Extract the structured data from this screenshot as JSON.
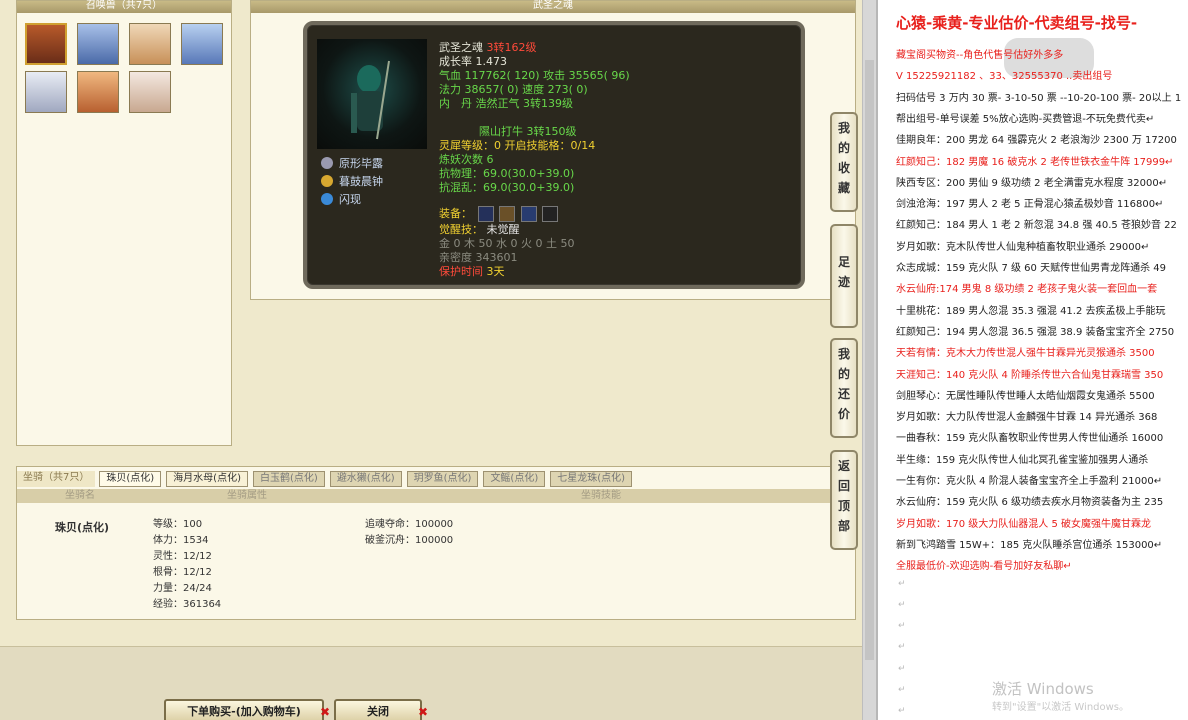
{
  "summon_panel": {
    "title": "召唤兽（共7只）"
  },
  "pet_frame": {
    "title": "武圣之魂"
  },
  "pet": {
    "name": "武圣之魂",
    "level": "3转162级",
    "growth": "成长率 1.473",
    "hp_label": "气血",
    "hp": "117762( 120)",
    "atk_label": "攻击",
    "atk": "35565( 96)",
    "mp_label": "法力",
    "mp": "38657( 0)",
    "spd_label": "速度",
    "spd": "273( 0)",
    "inner": "内　丹 浩然正气 3转139级",
    "city": "隰山打牛 3转150级",
    "rank_label": "灵犀等级",
    "rank": "：0 开启技能格：0/14",
    "refine": "炼妖次数 6",
    "resist1_label": "抗物理",
    "resist1": "69.0(30.0+39.0)",
    "resist2_label": "抗混乱",
    "resist2": "69.0(30.0+39.0)",
    "equip_label": "装备：",
    "awaken_label": "觉醒技：",
    "awaken": "未觉醒",
    "elements": "金 0 木 50 水 0 火 0 土 50",
    "intimacy": "亲密度 343601",
    "protect_label": "保护时间",
    "protect": "3天",
    "skills": [
      {
        "name": "原形毕露",
        "icon": "bone-skill-icon",
        "color": "#9a9ab0"
      },
      {
        "name": "暮鼓晨钟",
        "icon": "bell-skill-icon",
        "color": "#d8a830"
      },
      {
        "name": "闪现",
        "icon": "flash-skill-icon",
        "color": "#3a8ad8"
      }
    ]
  },
  "mount": {
    "tabs": [
      "坐骑（共7只）",
      "珠贝(点化)",
      "海月水母(点化)",
      "白玉鹤(点化)",
      "避水獭(点化)",
      "玥罗鱼(点化)",
      "文鳐(点化)",
      "七星龙珠(点化)"
    ],
    "col_name": "坐骑名",
    "col_attr": "坐骑属性",
    "col_skill": "坐骑技能",
    "name": "珠贝(点化)",
    "attrs": [
      "等级：100",
      "体力：1534",
      "灵性：12/12",
      "根骨：12/12",
      "力量：24/24",
      "经验：361364"
    ],
    "skills": [
      "追魂夺命：100000",
      "破釜沉舟：100000"
    ]
  },
  "buttons": {
    "buy": "下单购买-(加入购物车)",
    "close": "关闭",
    "x": "✖"
  },
  "side_nav": [
    {
      "label": "我的收藏",
      "chars": [
        "我",
        "的",
        "收",
        "藏"
      ]
    },
    {
      "label": "足迹",
      "chars": [
        "足",
        "迹"
      ]
    },
    {
      "label": "我的还价",
      "chars": [
        "我",
        "的",
        "还",
        "价"
      ]
    },
    {
      "label": "返回顶部",
      "chars": [
        "返",
        "回",
        "顶",
        "部"
      ]
    }
  ],
  "notepad": {
    "title": "心猿-乘黄-专业估价-代卖组号-找号-",
    "lines": [
      {
        "text": "藏宝阁买物资--角色代售号估好外多多",
        "red": true
      },
      {
        "text": "V 15225921182  、33、32555370  ..卖出组号",
        "red": true
      },
      {
        "text": "扫码估号 3 万内 30 票- 3-10-50 票  --10-20-100 票- 20以上 1",
        "red": false
      },
      {
        "text": "帮出组号-单号误差 5%放心选购-买费管退-不玩免费代卖↵",
        "red": false
      },
      {
        "text": "佳期良年：200 男龙 64 强霹克火 2 老浪淘沙 2300 万 17200",
        "red": false
      },
      {
        "text": "红颜知己：182 男魔 16 破克水 2 老传世铁衣金牛阵 17999↵",
        "red": true
      },
      {
        "text": "陕西专区：200 男仙 9 级功绩 2 老全满雷克水程度 32000↵",
        "red": false
      },
      {
        "text": "剑浊沧海：197 男人 2 老 5 正骨混心猿孟极妙音 116800↵",
        "red": false
      },
      {
        "text": "红颜知己：184 男人 1 老 2 新忽混 34.8 强 40.5 苍狼妙音 22",
        "red": false
      },
      {
        "text": "岁月如歌：克木队传世人仙鬼种植畜牧职业通杀 29000↵",
        "red": false
      },
      {
        "text": "众志成城：159 克火队 7 级 60 天赋传世仙男青龙阵通杀 49",
        "red": false
      },
      {
        "text": "水云仙府:174 男鬼 8 级功绩 2 老孩子鬼火装一套回血一套",
        "red": true
      },
      {
        "text": "十里桃花：189 男人忽混 35.3 强混 41.2 去疾孟极上手能玩",
        "red": false
      },
      {
        "text": "红颜知己：194 男人忽混 36.5 强混 38.9 装备宝宝齐全 2750",
        "red": false
      },
      {
        "text": "天若有情：克木大力传世混人强牛甘霖异光灵猴通杀 3500",
        "red": true
      },
      {
        "text": "天涯知己：140 克火队 4 阶睡杀传世六合仙鬼甘霖瑞雪 350",
        "red": true
      },
      {
        "text": "剑胆琴心：无属性睡队传世睡人太皓仙烟霞女鬼通杀 5500",
        "red": false
      },
      {
        "text": "岁月如歌：大力队传世混人金麟强牛甘霖 14 异光通杀 368",
        "red": false
      },
      {
        "text": "一曲春秋：159 克火队畜牧职业传世男人传世仙通杀 16000",
        "red": false
      },
      {
        "text": "半生缘：159 克火队传世人仙北冥孔雀宝鉴加强男人通杀",
        "red": false
      },
      {
        "text": "一生有你：克火队 4 阶混人装备宝宝齐全上手盈利 21000↵",
        "red": false
      },
      {
        "text": "水云仙府：159 克火队 6 级功绩去疾水月物资装备为主 235",
        "red": false
      },
      {
        "text": "岁月如歌：170 级大力队仙器混人 5 破女魔强牛魔甘霖龙",
        "red": true
      },
      {
        "text": "新到飞鸿踏雪 15W+：185 克火队睡杀宫位通杀 153000↵",
        "red": false
      },
      {
        "text": "全服最低价-欢迎选购-看号加好友私聊↵",
        "red": true
      }
    ],
    "empty_marks": [
      "↵",
      "↵",
      "↵",
      "↵",
      "↵",
      "↵",
      "↵",
      "↵"
    ],
    "watermark_title": "激活 Windows",
    "watermark_sub": "转到\"设置\"以激活 Windows。"
  }
}
